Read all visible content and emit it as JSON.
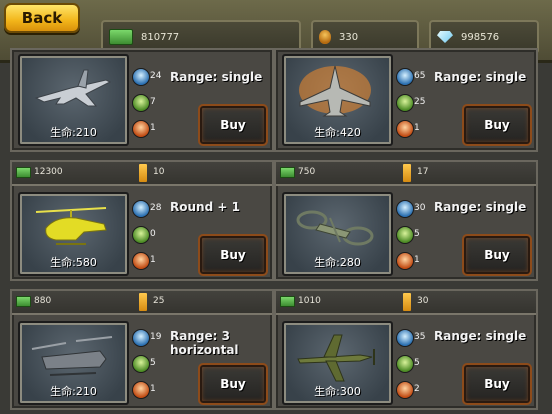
{
  "header": {
    "back_label": "Back",
    "cash": "810777",
    "oil": "330",
    "gems": "998576"
  },
  "units": [
    {
      "price": "",
      "oil": "",
      "hp": "生命:210",
      "attack": "24",
      "armor": "7",
      "crew": "1",
      "range": "Range: single",
      "buy": "Buy",
      "kind": "fighter-jet"
    },
    {
      "price": "",
      "oil": "",
      "hp": "生命:420",
      "attack": "65",
      "armor": "25",
      "crew": "1",
      "range": "Range: single",
      "buy": "Buy",
      "kind": "fighter-jet-flame"
    },
    {
      "price": "12300",
      "oil": "10",
      "hp": "生命:580",
      "attack": "28",
      "armor": "0",
      "crew": "1",
      "range": "Round + 1",
      "buy": "Buy",
      "kind": "helicopter"
    },
    {
      "price": "750",
      "oil": "17",
      "hp": "生命:280",
      "attack": "30",
      "armor": "5",
      "crew": "1",
      "range": "Range: single",
      "buy": "Buy",
      "kind": "gyrocopter"
    },
    {
      "price": "880",
      "oil": "25",
      "hp": "生命:210",
      "attack": "19",
      "armor": "5",
      "crew": "1",
      "range": "Range: 3 horizontal",
      "buy": "Buy",
      "kind": "chinook"
    },
    {
      "price": "1010",
      "oil": "30",
      "hp": "生命:300",
      "attack": "35",
      "armor": "5",
      "crew": "2",
      "range": "Range: single",
      "buy": "Buy",
      "kind": "propeller-plane"
    }
  ]
}
